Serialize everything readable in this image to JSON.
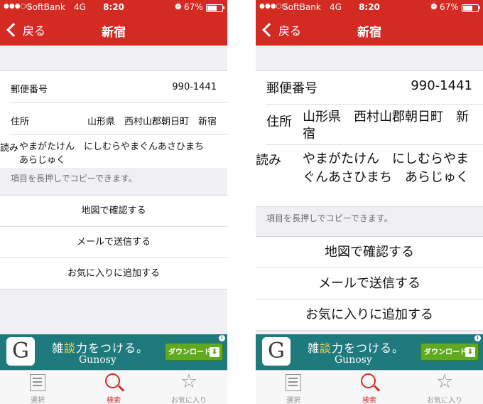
{
  "status": {
    "signal": "●●●○○",
    "carrier": "SoftBank",
    "network": "4G",
    "time": "8:20",
    "alarm_icon": "⏰",
    "battery": "67%",
    "battery_level": 0.67
  },
  "nav": {
    "back_label": "戻る",
    "title": "新宿"
  },
  "detail": {
    "postal_label": "郵便番号",
    "postal_value": "990-1441",
    "address_label": "住所",
    "address_value": "山形県　西村山郡朝日町　新宿",
    "reading_label": "読み",
    "reading_value": "やまがたけん　にしむらやまぐんあさひまち　あらじゅく"
  },
  "note": "項目を長押しでコピーできます。",
  "actions": [
    "地図で確認する",
    "メールで送信する",
    "お気に入りに追加する"
  ],
  "ad": {
    "icon_letter": "G",
    "headline": "雑談力をつける。",
    "brand": "Gunosy",
    "download_label": "ダウンロード",
    "download_icon": "⬇",
    "info_icon": "i",
    "accent_color": "#f0d050",
    "bg_color": "#1f7a7d"
  },
  "tabs": [
    {
      "label": "選択",
      "icon": "list-icon"
    },
    {
      "label": "検索",
      "icon": "search-icon",
      "active": true
    },
    {
      "label": "お気に入り",
      "icon": "star-icon",
      "glyph": "☆"
    }
  ],
  "colors": {
    "brand_red": "#d32b22",
    "tab_inactive": "#929292"
  }
}
